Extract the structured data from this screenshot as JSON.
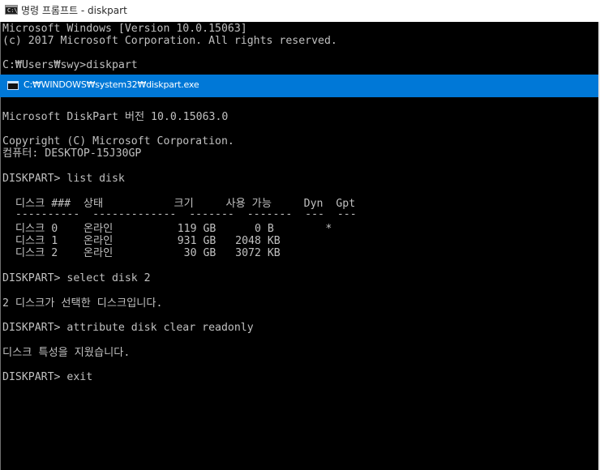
{
  "window": {
    "title": "명령 프롬프트 - diskpart",
    "icon": "cmd-icon"
  },
  "inner_window": {
    "title": "C:₩WINDOWS₩system32₩diskpart.exe",
    "accent_color": "#0078d7"
  },
  "console": {
    "line1": "Microsoft Windows [Version 10.0.15063]",
    "line2": "(c) 2017 Microsoft Corporation. All rights reserved.",
    "line3": "C:₩Users₩swy>diskpart",
    "line4": "Microsoft DiskPart 버전 10.0.15063.0",
    "line5": "Copyright (C) Microsoft Corporation.",
    "line6": "컴퓨터: DESKTOP-15J30GP",
    "line7": "DISKPART> list disk",
    "header": "  디스크 ###  상태           크기     사용 가능     Dyn  Gpt",
    "separator": "  ----------  -------------  -------  -------  ---  ---",
    "row0": "  디스크 0    온라인          119 GB      0 B        *",
    "row1": "  디스크 1    온라인          931 GB   2048 KB",
    "row2": "  디스크 2    온라인           30 GB   3072 KB",
    "line8": "DISKPART> select disk 2",
    "line9": "2 디스크가 선택한 디스크입니다.",
    "line10": "DISKPART> attribute disk clear readonly",
    "line11": "디스크 특성을 지웠습니다.",
    "line12": "DISKPART> exit"
  }
}
